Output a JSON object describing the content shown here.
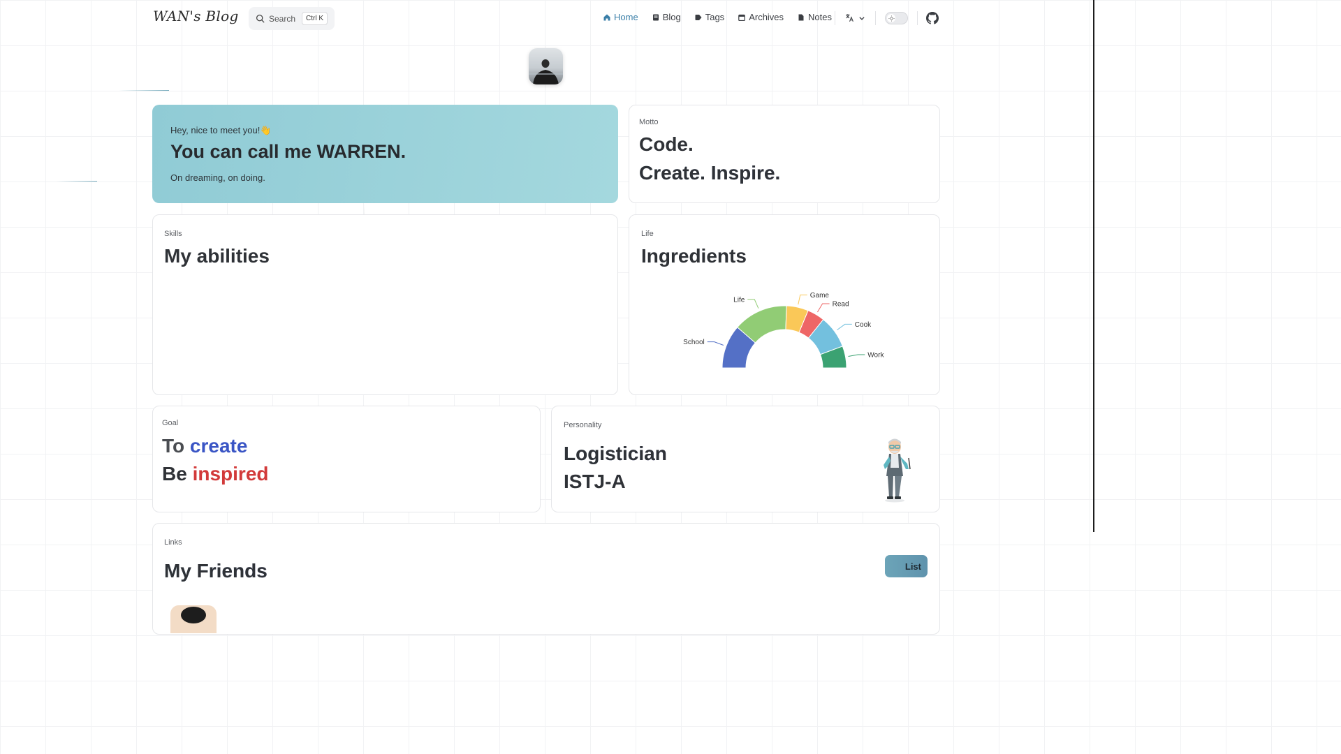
{
  "header": {
    "logo": "WAN's Blog",
    "search": {
      "placeholder": "Search",
      "shortcut": "Ctrl K"
    },
    "nav": [
      {
        "label": "Home",
        "icon": "home-icon",
        "active": true
      },
      {
        "label": "Blog",
        "icon": "book-icon",
        "active": false
      },
      {
        "label": "Tags",
        "icon": "tag-icon",
        "active": false
      },
      {
        "label": "Archives",
        "icon": "calendar-icon",
        "active": false
      },
      {
        "label": "Notes",
        "icon": "file-icon",
        "active": false
      }
    ],
    "language_icon": "translate-icon",
    "theme_toggle": "sun-icon",
    "github_icon": "github-icon"
  },
  "intro": {
    "greeting": "Hey, nice to meet you!",
    "wave": "👋",
    "name_line": "You can call me WARREN.",
    "tagline": "On dreaming, on doing."
  },
  "motto": {
    "eyebrow": "Motto",
    "line1": "Code.",
    "line2": "Create. Inspire."
  },
  "skills": {
    "eyebrow": "Skills",
    "title": "My abilities"
  },
  "life": {
    "eyebrow": "Life",
    "title": "Ingredients"
  },
  "chart_data": {
    "type": "pie",
    "variant": "half-donut",
    "categories": [
      "School",
      "Life",
      "Game",
      "Read",
      "Cook",
      "Work"
    ],
    "values": [
      20,
      25,
      10,
      8,
      15,
      10
    ],
    "colors": [
      "#5470c6",
      "#91cc75",
      "#fac858",
      "#ee6666",
      "#73c0de",
      "#3ba272"
    ]
  },
  "goal": {
    "eyebrow": "Goal",
    "line1_prefix": "To ",
    "line1_highlight": "create",
    "line2_prefix": "Be ",
    "line2_highlight": "inspired",
    "colors": {
      "create": "#3a55c5",
      "inspired": "#d23a3a"
    }
  },
  "personality": {
    "eyebrow": "Personality",
    "type_name": "Logistician",
    "type_code": "ISTJ-A"
  },
  "links": {
    "eyebrow": "Links",
    "title": "My Friends",
    "list_button": "List"
  }
}
